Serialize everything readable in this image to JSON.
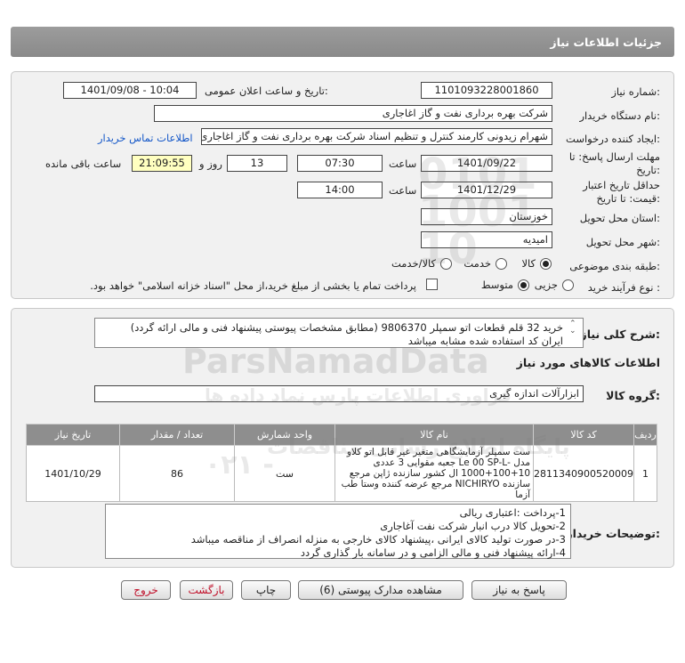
{
  "header": {
    "title": "جزئیات اطلاعات نیاز"
  },
  "info": {
    "need_number_label": "شماره نیاز:",
    "need_number": "1101093228001860",
    "announce_label": "تاریخ و ساعت اعلان عمومی:",
    "announce_value": "1401/09/08 - 10:04",
    "buyer_label": "نام دستگاه خریدار:",
    "buyer_value": "شرکت بهره برداری نفت و گاز اغاجاری",
    "creator_label": "ایجاد کننده درخواست:",
    "creator_value": "شهرام زیدونی کارمند کنترل و تنظیم اسناد شرکت بهره برداری نفت و گاز اغاجاری",
    "contact_link": "اطلاعات تماس خریدار",
    "deadline_label": "مهلت ارسال پاسخ: تا تاریخ:",
    "deadline_date": "1401/09/22",
    "time_word": "ساعت",
    "deadline_time": "07:30",
    "days": "13",
    "day_and": "روز و",
    "countdown": "21:09:55",
    "remaining": "ساعت باقی مانده",
    "validity_label": "حداقل تاریخ اعتبار قیمت: تا تاریخ:",
    "validity_date": "1401/12/29",
    "validity_time": "14:00",
    "province_label": "استان محل تحویل:",
    "province_value": "خوزستان",
    "city_label": "شهر محل تحویل:",
    "city_value": "امیدیه",
    "category_label": "طبقه بندی موضوعی:",
    "cat_goods": "کالا",
    "cat_service": "خدمت",
    "cat_both": "کالا/خدمت",
    "process_label": "نوع فرآیند خرید :",
    "proc_partial": "جزیی",
    "proc_medium": "متوسط",
    "payment_note": "پرداخت تمام یا بخشی از مبلغ خرید،از محل \"اسناد خزانه اسلامی\" خواهد بود."
  },
  "description": {
    "label": "شرح کلی نیاز:",
    "line1": "خرید 32 قلم قطعات اتو سمپلر 9806370 (مطابق مشخصات پیوستی پیشنهاد فنی و مالی ارائه گردد)",
    "line2": "ایران کد استفاده شده مشابه میباشد"
  },
  "goods": {
    "section_title": "اطلاعات کالاهای مورد نیاز",
    "group_label": "گروه کالا:",
    "group_value": "ابزارآلات اندازه گیری"
  },
  "table": {
    "headers": [
      "ردیف",
      "کد کالا",
      "نام کالا",
      "واحد شمارش",
      "تعداد / مقدار",
      "تاریخ نیاز"
    ],
    "rows": [
      {
        "row": "1",
        "code": "2811340900520009",
        "name": "ست سمپلر آزمایشگاهی متغیر غیر قابل اتو کلاو مدل -Le 00 SP-L جعبه مقوایی 3 عددی 10+100+1000 ال کشور سازنده ژاپن مرجع سازنده NICHIRYO مرجع عرضه کننده وستا طب آزما",
        "unit": "ست",
        "qty": "86",
        "date": "1401/10/29"
      }
    ]
  },
  "buyer_notes": {
    "label": "توضیحات خریدار:",
    "lines": [
      "1-پرداخت :اعتباری ریالی",
      "2-تحویل کالا درب انبار شرکت نفت آغاجاری",
      "3-در صورت تولید کالای ایرانی ،پیشنهاد کالای خارجی به منزله انصراف از مناقصه میباشد",
      "4-ارائه پیشنهاد فنی و مالی الزامی و در سامانه بار گذاری گردد"
    ]
  },
  "buttons": {
    "reply": "پاسخ به نیاز",
    "view_docs": "مشاهده مدارک پیوستی (6)",
    "print": "چاپ",
    "back": "بازگشت",
    "exit": "خروج"
  },
  "watermark": {
    "brand": "ParsNamadData",
    "tagline": "پایگاه اطلاع رسانی مناقصات",
    "tagline2": "فراوری اطلاعات پارس نماد داده ها",
    "phone": "۰۲۱ -"
  }
}
